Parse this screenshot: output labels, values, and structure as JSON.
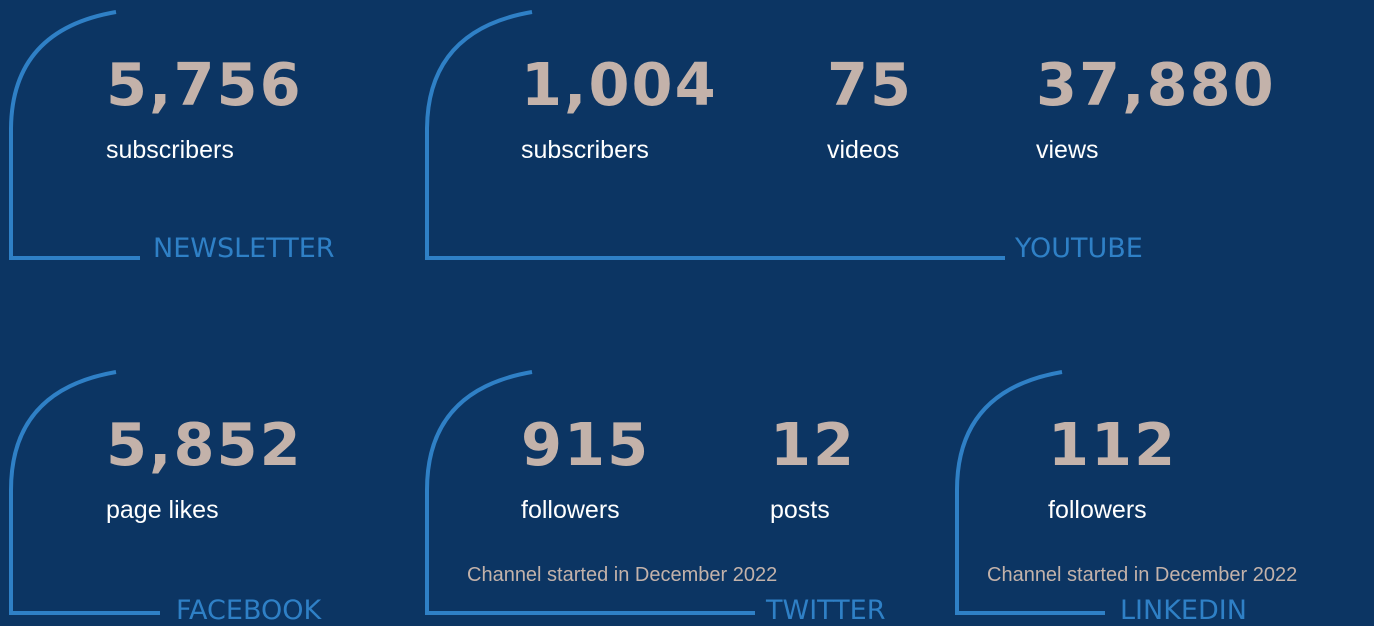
{
  "theme": {
    "background": "#0c3563",
    "accent": "#2f80c6",
    "number_color": "#c3b2aa",
    "label_color": "#ffffff"
  },
  "newsletter": {
    "title": "NEWSLETTER",
    "stats": [
      {
        "value": "5,756",
        "label": "subscribers"
      }
    ]
  },
  "youtube": {
    "title": "YOUTUBE",
    "stats": [
      {
        "value": "1,004",
        "label": "subscribers"
      },
      {
        "value": "75",
        "label": "videos"
      },
      {
        "value": "37,880",
        "label": "views"
      }
    ]
  },
  "facebook": {
    "title": "FACEBOOK",
    "stats": [
      {
        "value": "5,852",
        "label": "page likes"
      }
    ]
  },
  "twitter": {
    "title": "TWITTER",
    "stats": [
      {
        "value": "915",
        "label": "followers"
      },
      {
        "value": "12",
        "label": "posts"
      }
    ],
    "note": "Channel started in December 2022"
  },
  "linkedin": {
    "title": "LINKEDIN",
    "stats": [
      {
        "value": "112",
        "label": "followers"
      }
    ],
    "note": "Channel started in December 2022"
  }
}
